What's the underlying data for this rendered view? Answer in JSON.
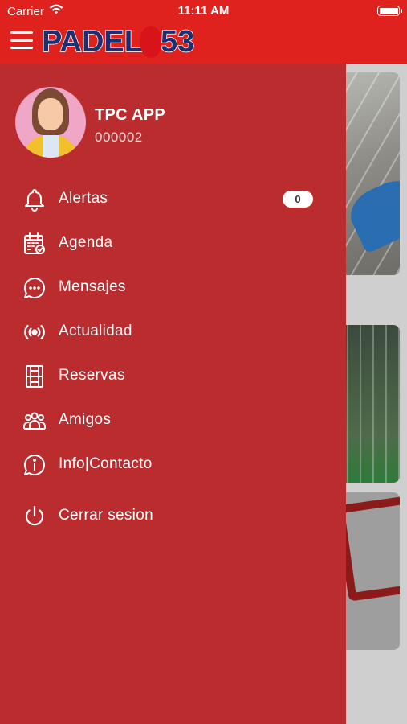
{
  "status_bar": {
    "carrier": "Carrier",
    "time": "11:11 AM"
  },
  "header": {
    "logo_left": "PADEL",
    "logo_right": "53"
  },
  "profile": {
    "name": "TPC APP",
    "id": "000002"
  },
  "menu": [
    {
      "label": "Alertas",
      "icon": "bell-icon",
      "badge": "0"
    },
    {
      "label": "Agenda",
      "icon": "calendar-icon"
    },
    {
      "label": "Mensajes",
      "icon": "chat-icon"
    },
    {
      "label": "Actualidad",
      "icon": "broadcast-icon"
    },
    {
      "label": "Reservas",
      "icon": "court-icon"
    },
    {
      "label": "Amigos",
      "icon": "friends-icon"
    },
    {
      "label": "Info|Contacto",
      "icon": "info-icon"
    },
    {
      "label": "Cerrar sesion",
      "icon": "power-icon"
    }
  ],
  "colors": {
    "header": "#e0221f",
    "drawer": "#bb2c2f",
    "logo_text": "#1d2f6f"
  }
}
